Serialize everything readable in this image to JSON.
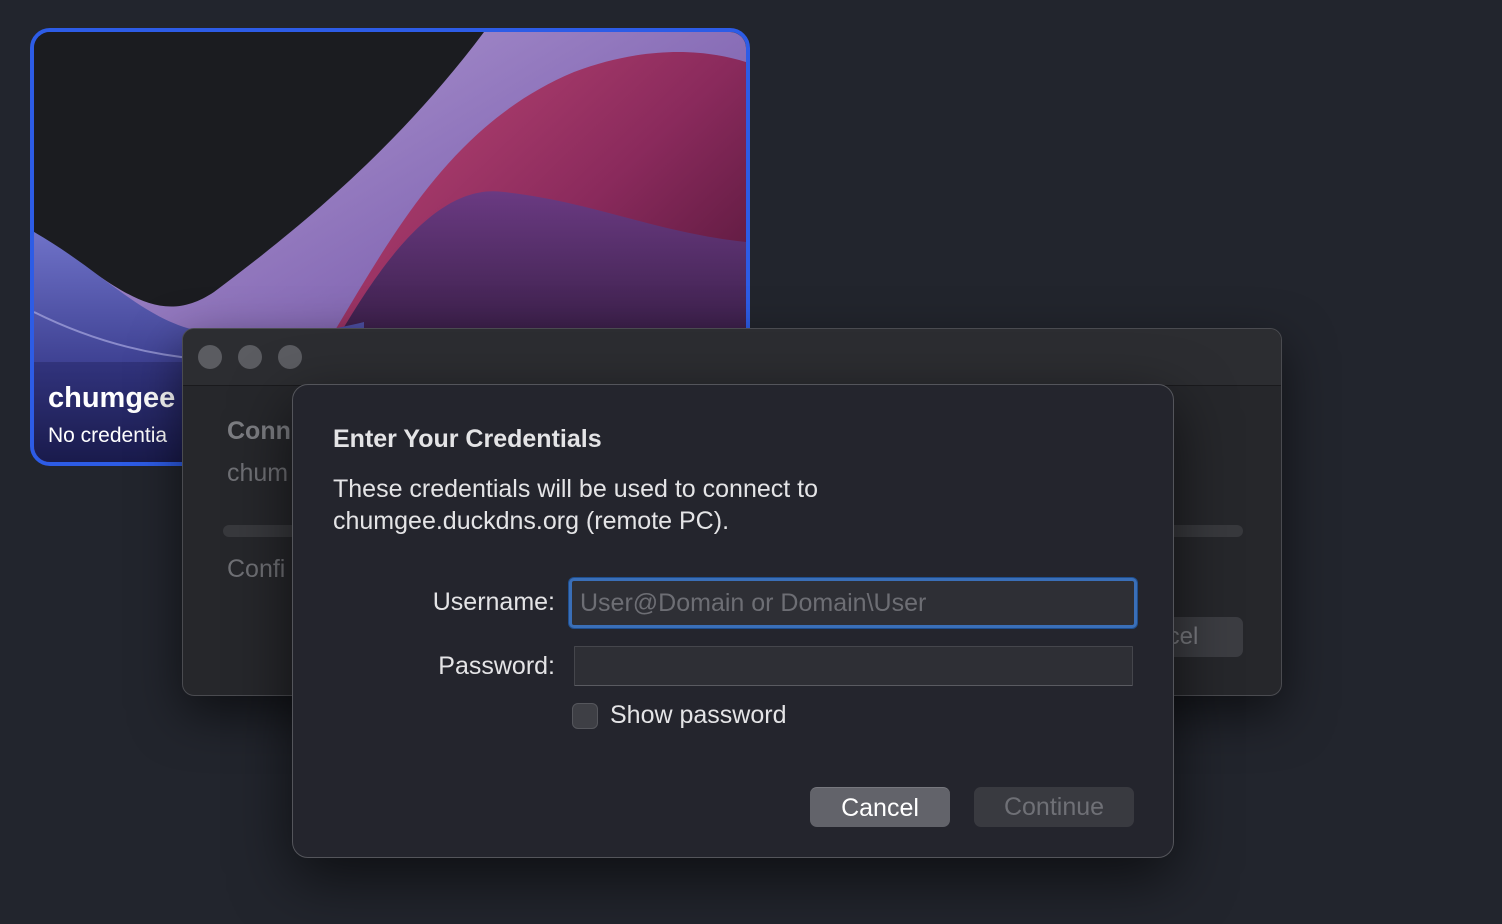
{
  "pc_tile": {
    "name": "chumgee",
    "status": "No credentia",
    "accent_color": "#2d5ce6"
  },
  "connecting_window": {
    "title": "Conn",
    "host": "chum",
    "config_text": "Confi",
    "cancel_label": "cel"
  },
  "credentials_dialog": {
    "title": "Enter Your Credentials",
    "description_line1": "These credentials will be used to connect to",
    "description_line2": "chumgee.duckdns.org (remote PC).",
    "username_label": "Username:",
    "username_placeholder": "User@Domain or Domain\\User",
    "username_value": "",
    "password_label": "Password:",
    "password_value": "",
    "show_password_label": "Show password",
    "show_password_checked": false,
    "cancel_label": "Cancel",
    "continue_label": "Continue"
  }
}
